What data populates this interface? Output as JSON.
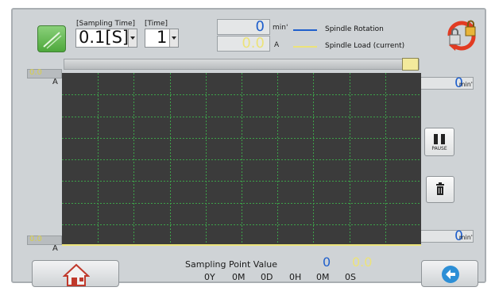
{
  "toolbar": {
    "sampling_time_label": "[Sampling Time]",
    "sampling_time_value": "0.1[S]",
    "time_label": "[Time]",
    "time_value": "1"
  },
  "readouts": {
    "rotation_value": "0",
    "rotation_unit": "min'",
    "load_value": "0.0",
    "load_unit": "A"
  },
  "legend": [
    {
      "label": "Spindle Rotation",
      "color": "#1f5fcc"
    },
    {
      "label": "Spindle Load (current)",
      "color": "#ece37a"
    }
  ],
  "left_axis": {
    "top_value": "0.0",
    "top_unit": "A",
    "bottom_value": "0.0",
    "bottom_unit": "A"
  },
  "right_axis": {
    "top_value": "0",
    "top_unit": "min'",
    "bottom_value": "0",
    "bottom_unit": "min'"
  },
  "controls": {
    "pause_label": "PAUSE"
  },
  "sampling_point": {
    "label": "Sampling Point Value",
    "rotation_value": "0",
    "load_value": "0.0",
    "elapsed": [
      {
        "value": "0",
        "unit": "Y"
      },
      {
        "value": "0",
        "unit": "M"
      },
      {
        "value": "0",
        "unit": "D"
      },
      {
        "value": "0",
        "unit": "H"
      },
      {
        "value": "0",
        "unit": "M"
      },
      {
        "value": "0",
        "unit": "S"
      }
    ]
  },
  "plot": {
    "background": "#3b3b3b",
    "grid_color": "#3da34a",
    "vertical_divisions": 10,
    "horizontal_divisions": 8,
    "load_trace_color": "#ece37a"
  },
  "icons": {
    "graph": "graph-icon",
    "lock": "lock-switch-icon",
    "home": "home-icon",
    "back": "back-arrow-icon",
    "trash": "trash-icon",
    "pause": "pause-icon"
  }
}
